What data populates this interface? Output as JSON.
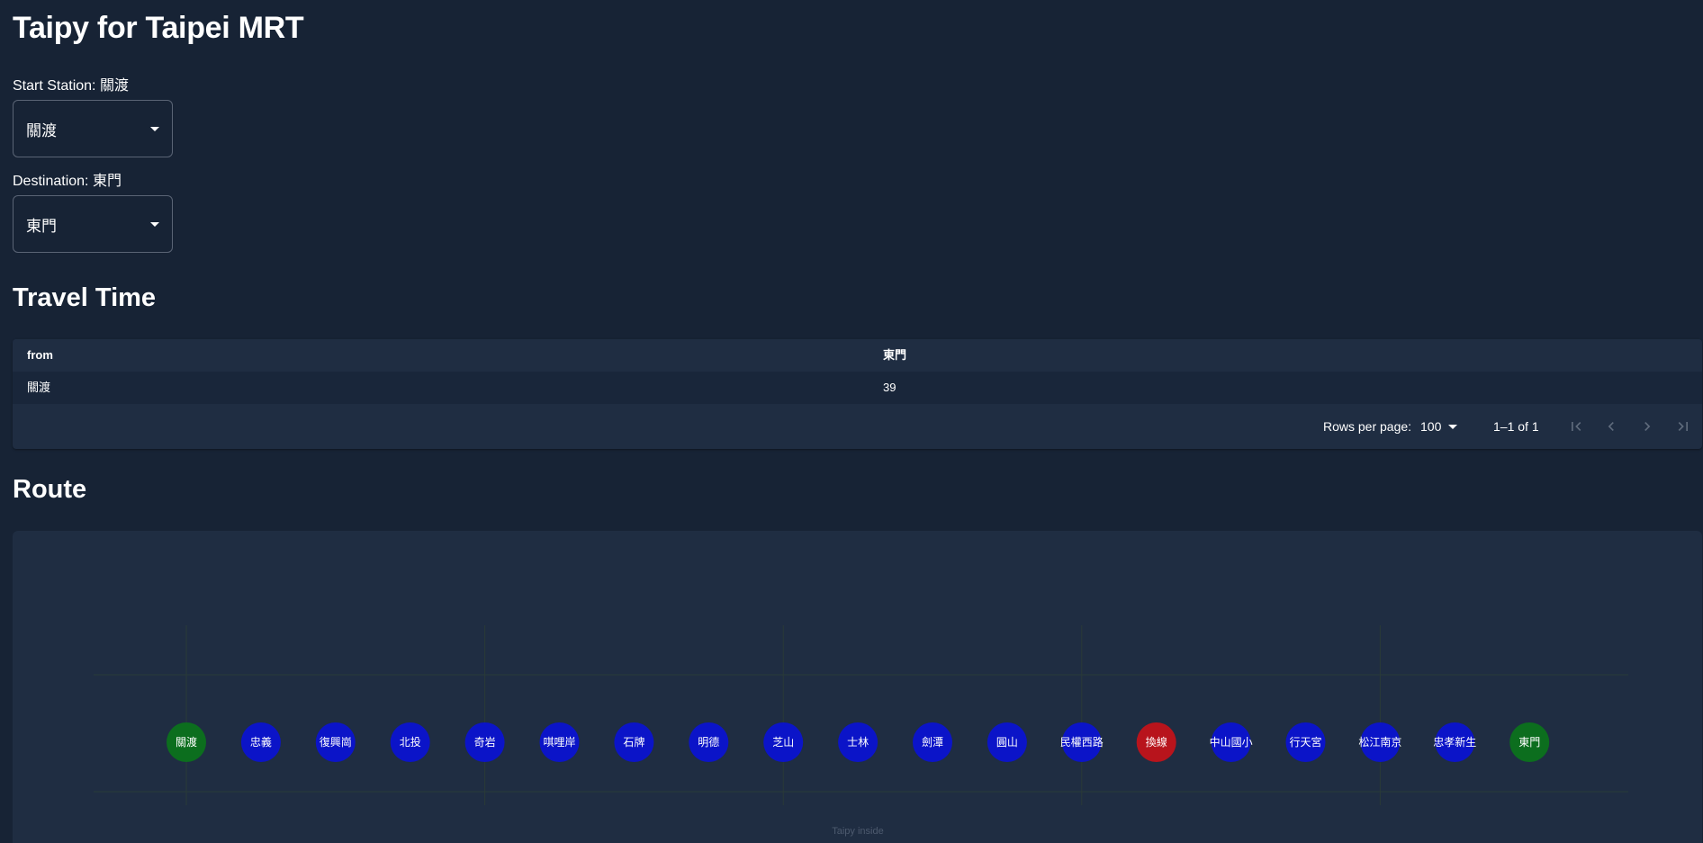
{
  "app": {
    "title": "Taipy for Taipei MRT"
  },
  "selectors": {
    "start": {
      "label": "Start Station: 關渡",
      "value": "關渡"
    },
    "destination": {
      "label": "Destination: 東門",
      "value": "東門"
    }
  },
  "travel_time": {
    "title": "Travel Time",
    "columns": [
      "from",
      "東門"
    ],
    "rows": [
      [
        "關渡",
        "39"
      ]
    ],
    "pagination": {
      "rows_per_page_label": "Rows per page:",
      "rows_per_page_value": "100",
      "range_text": "1–1 of 1",
      "icons": [
        "first-page-icon",
        "previous-page-icon",
        "next-page-icon",
        "last-page-icon"
      ]
    }
  },
  "route": {
    "title": "Route",
    "watermark": "Taipy inside",
    "colors": {
      "terminal": "#0c6e1e",
      "station": "#0b14c8",
      "transfer": "#b8141c",
      "grid": "#2a3a38"
    },
    "chart_data": {
      "type": "scatter",
      "x": [
        "關渡",
        "忠義",
        "復興崗",
        "北投",
        "奇岩",
        "唭哩岸",
        "石牌",
        "明德",
        "芝山",
        "士林",
        "劍潭",
        "圓山",
        "民權西路",
        "換線",
        "中山國小",
        "行天宮",
        "松江南京",
        "忠孝新生",
        "東門"
      ],
      "kinds": [
        "terminal",
        "station",
        "station",
        "station",
        "station",
        "station",
        "station",
        "station",
        "station",
        "station",
        "station",
        "station",
        "station",
        "transfer",
        "station",
        "station",
        "station",
        "station",
        "terminal"
      ],
      "grid": true,
      "legend": false,
      "title": "",
      "xlabel": "",
      "ylabel": ""
    }
  }
}
